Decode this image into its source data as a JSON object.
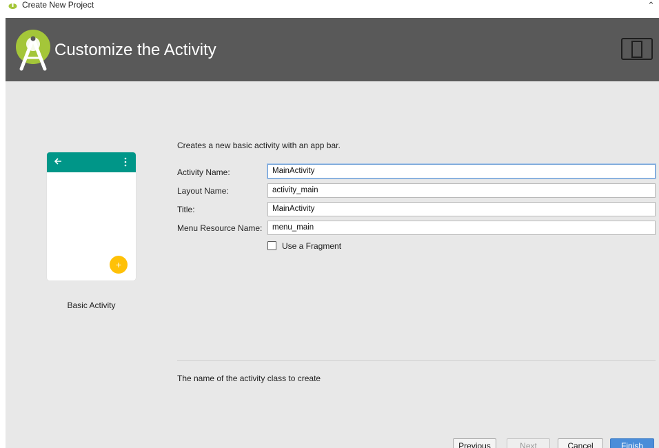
{
  "window": {
    "title": "Create New Project"
  },
  "banner": {
    "heading": "Customize the Activity"
  },
  "template": {
    "name": "Basic Activity"
  },
  "form": {
    "description": "Creates a new basic activity with an app bar.",
    "fields": [
      {
        "label": "Activity Name:",
        "value": "MainActivity"
      },
      {
        "label": "Layout Name:",
        "value": "activity_main"
      },
      {
        "label": "Title:",
        "value": "MainActivity"
      },
      {
        "label": "Menu Resource Name:",
        "value": "menu_main"
      }
    ],
    "use_fragment": {
      "label": "Use a Fragment",
      "checked": false
    },
    "help_text": "The name of the activity class to create"
  },
  "buttons": {
    "previous": "Previous",
    "next": "Next",
    "cancel": "Cancel",
    "finish": "Finish"
  },
  "colors": {
    "banner_bg": "#595959",
    "content_bg": "#e8e8e8",
    "app_bar": "#009688",
    "fab": "#ffc107",
    "primary_button": "#4a8dd9",
    "android_green": "#a4c639"
  },
  "icons": {
    "window_icon": "android-studio-icon",
    "banner_logo": "android-studio-logo",
    "device_frame": "device-frame-icon",
    "back_arrow": "arrow-back-icon",
    "overflow_menu": "more-vert-icon",
    "fab_icon": "plus-icon",
    "collapse": "chevron-up-icon"
  }
}
